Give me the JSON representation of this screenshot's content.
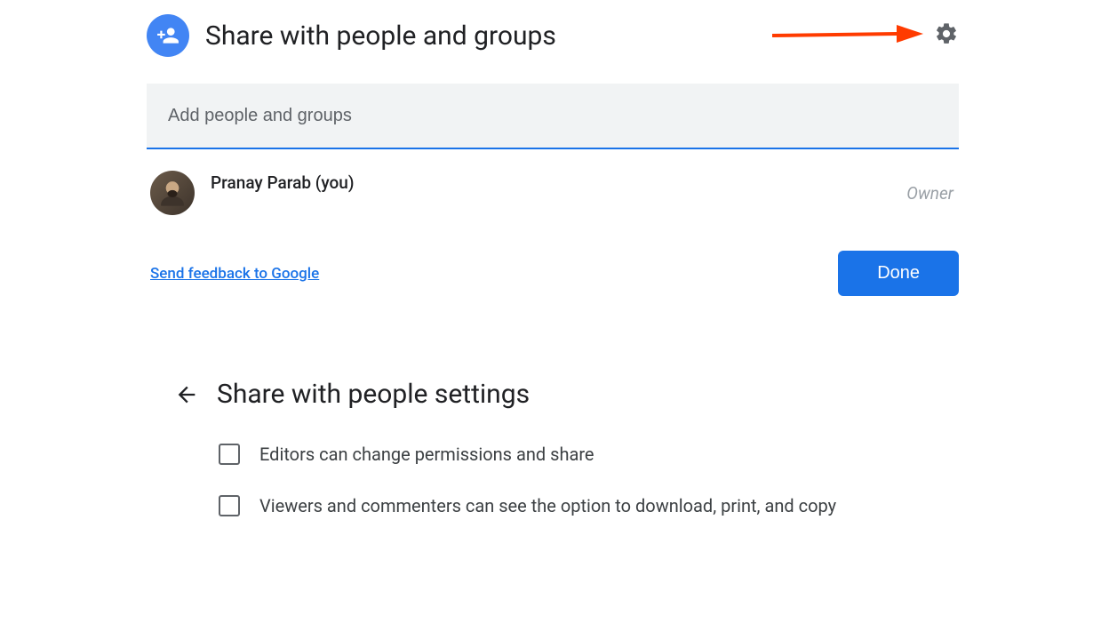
{
  "dialog": {
    "title": "Share with people and groups",
    "input_placeholder": "Add people and groups",
    "person": {
      "name": "Pranay Parab (you)",
      "role": "Owner"
    },
    "feedback_link": "Send feedback to Google",
    "done_button": "Done"
  },
  "settings": {
    "title": "Share with people settings",
    "options": [
      "Editors can change permissions and share",
      "Viewers and commenters can see the option to download, print, and copy"
    ]
  }
}
